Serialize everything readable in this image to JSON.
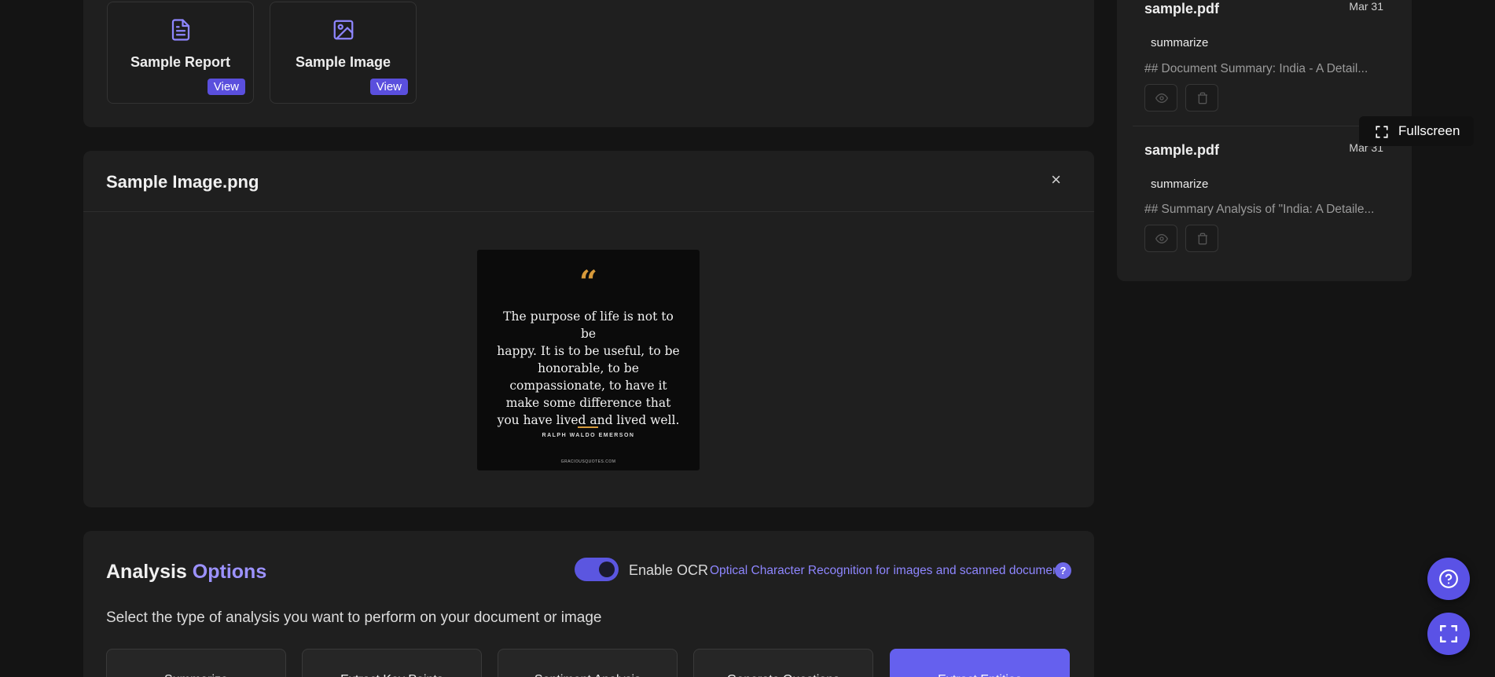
{
  "samples": {
    "cards": [
      {
        "title": "Sample Report",
        "view_label": "View",
        "icon": "document-icon"
      },
      {
        "title": "Sample Image",
        "view_label": "View",
        "icon": "image-icon"
      }
    ]
  },
  "preview": {
    "title": "Sample Image.png",
    "close_label": "×",
    "quote": {
      "marks": "“",
      "lines": [
        "The purpose of life is not to be",
        "happy. It is to be useful, to be",
        "honorable, to be",
        "compassionate, to have it",
        "make some difference that",
        "you have lived and lived well."
      ],
      "author": "RALPH WALDO EMERSON",
      "site": "GRACIOUSQUOTES.COM"
    }
  },
  "analysis": {
    "title_main": "Analysis",
    "title_accent": "Options",
    "ocr_label": "Enable OCR",
    "ocr_enabled": true,
    "ocr_desc": "Optical Character Recognition for images and scanned documents",
    "help_label": "?",
    "subtitle": "Select the type of analysis you want to perform on your document or image",
    "options": [
      "Summarize",
      "Extract Key Points",
      "Sentiment Analysis",
      "Generate Questions",
      "Extract Entities"
    ],
    "active_option": "Extract Entities"
  },
  "history": {
    "items": [
      {
        "file": "sample.pdf",
        "date": "Mar 31",
        "tag": "summarize",
        "preview": "## Document Summary: India - A Detail..."
      },
      {
        "file": "sample.pdf",
        "date": "Mar 31",
        "tag": "summarize",
        "preview": "## Summary Analysis of \"India: A Detaile..."
      }
    ]
  },
  "tooltip": {
    "label": "Fullscreen"
  },
  "colors": {
    "accent": "#5a4fdd",
    "accent_light": "#9c92ff",
    "background": "#141414",
    "panel": "#1f1f1f"
  }
}
